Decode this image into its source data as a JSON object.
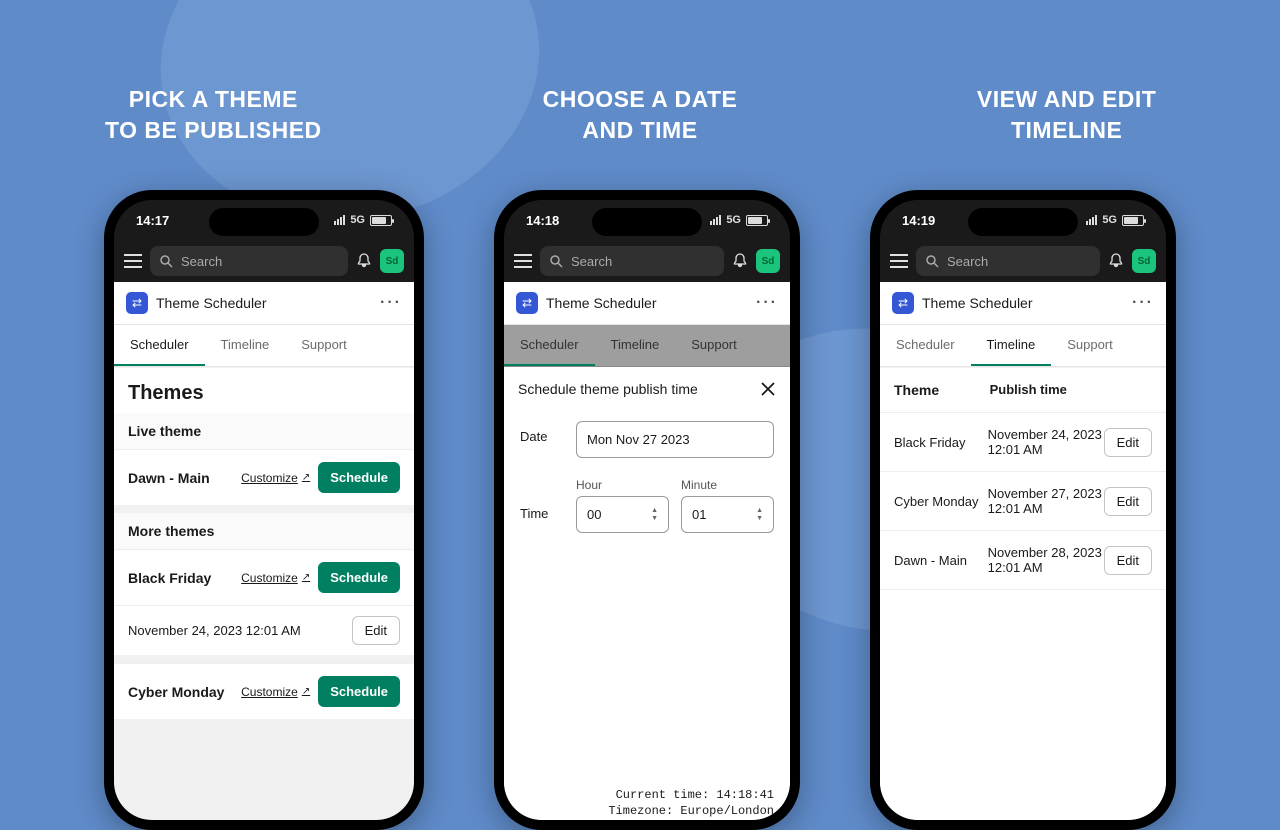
{
  "captions": {
    "c1": "PICK A THEME\nTO BE PUBLISHED",
    "c2": "CHOOSE A DATE\nAND TIME",
    "c3": "VIEW AND EDIT\nTIMELINE"
  },
  "topbar": {
    "search_placeholder": "Search",
    "avatar": "Sd"
  },
  "app": {
    "name": "Theme Scheduler",
    "tabs": {
      "scheduler": "Scheduler",
      "timeline": "Timeline",
      "support": "Support"
    }
  },
  "phone1": {
    "status_time": "14:17",
    "network": "5G",
    "themes_header": "Themes",
    "live_header": "Live theme",
    "live_theme": "Dawn - Main",
    "customize": "Customize",
    "schedule": "Schedule",
    "more_header": "More themes",
    "black_friday": "Black Friday",
    "bf_timestamp": "November 24, 2023 12:01 AM",
    "edit": "Edit",
    "cyber_monday": "Cyber Monday"
  },
  "phone2": {
    "status_time": "14:18",
    "network": "5G",
    "modal_title": "Schedule theme publish time",
    "date_label": "Date",
    "date_value": "Mon Nov 27 2023",
    "time_label": "Time",
    "hour_label": "Hour",
    "hour_value": "00",
    "minute_label": "Minute",
    "minute_value": "01",
    "current_time": "Current time: 14:18:41",
    "timezone": "Timezone: Europe/London"
  },
  "phone3": {
    "status_time": "14:19",
    "network": "5G",
    "col_theme": "Theme",
    "col_publish": "Publish time",
    "rows": [
      {
        "theme": "Black Friday",
        "time": "November 24, 2023 12:01 AM"
      },
      {
        "theme": "Cyber Monday",
        "time": "November 27, 2023 12:01 AM"
      },
      {
        "theme": "Dawn - Main",
        "time": "November 28, 2023 12:01 AM"
      }
    ],
    "edit": "Edit"
  }
}
